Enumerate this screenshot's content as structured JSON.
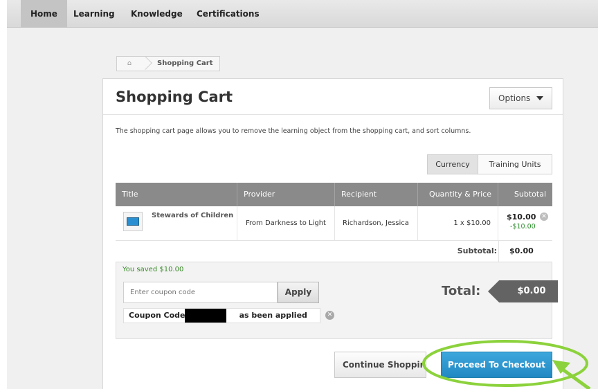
{
  "nav": {
    "items": [
      "Home",
      "Learning",
      "Knowledge",
      "Certifications"
    ],
    "active": "Home"
  },
  "breadcrumb": {
    "home_icon": "home-icon",
    "label": "Shopping Cart"
  },
  "page": {
    "title": "Shopping Cart",
    "options_label": "Options",
    "description": "The shopping cart page allows you to remove the learning object from the shopping cart, and sort columns."
  },
  "toggle": {
    "currency": "Currency",
    "training_units": "Training Units",
    "selected": "Currency"
  },
  "table": {
    "headers": [
      "Title",
      "Provider",
      "Recipient",
      "Quantity & Price",
      "Subtotal"
    ],
    "rows": [
      {
        "title": "Stewards of Children",
        "provider": "From Darkness to Light",
        "recipient": "Richardson, Jessica",
        "quantity_price": "1 x $10.00",
        "subtotal": "$10.00",
        "discount": "-$10.00",
        "icon": "computer-icon"
      }
    ]
  },
  "summary": {
    "subtotal_label": "Subtotal:",
    "subtotal_value": "$0.00"
  },
  "coupon": {
    "saved_text": "You saved $10.00",
    "placeholder": "Enter coupon code",
    "apply_label": "Apply",
    "applied_prefix": "Coupon Code:",
    "applied_suffix": "as been applied"
  },
  "total": {
    "label": "Total:",
    "value": "$0.00"
  },
  "actions": {
    "continue_label": "Continue Shopping",
    "checkout_label": "Proceed To Checkout"
  },
  "colors": {
    "accent": "#2288c2",
    "highlight": "#8cd23c",
    "discount": "#2a8a2a",
    "header": "#8a8a8a"
  }
}
